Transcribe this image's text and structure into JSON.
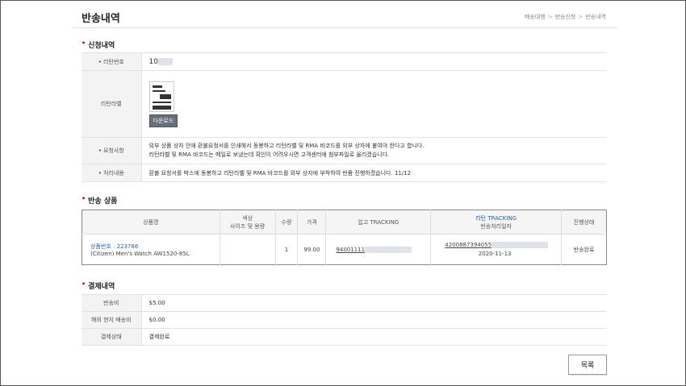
{
  "page": {
    "title": "반송내역",
    "breadcrumb": [
      "배송대행",
      "반송신청",
      "반송내역"
    ]
  },
  "application": {
    "section_title": "신청내역",
    "return_number": {
      "label": "리턴번호",
      "value": "10"
    },
    "return_label": {
      "label": "리턴라벨",
      "download_label": "다운로드"
    },
    "request": {
      "label": "요청사항",
      "line1": "외부 상품 상자 안에 환불요청서를 인쇄해서 동봉하고 리턴라벨 및 RMA 바코드를 외부 상자에 붙여야 한다고 합니다.",
      "line2": "리턴라벨 및 RMA 바코드는 메일로 보냈는데 확인이 어려우시면 고객센터에 첨부파일로 올리겠습니다."
    },
    "processing": {
      "label": "처리내용",
      "value": "환불 요청서를 박스에 동봉하고 리턴라벨 및 RMA 바코드를 외부 상자에 부착하여 반품 진행하겠습니다. 11/12"
    }
  },
  "products": {
    "section_title": "반송 상품",
    "headers": {
      "name": "상품명",
      "color": "색상",
      "size": "사이즈 및 용량",
      "qty": "수량",
      "price": "가격",
      "in_tracking": "입고 TRACKING",
      "return_tracking": "리턴 TRACKING",
      "return_date": "반송처리일자",
      "status": "진행상태"
    },
    "rows": [
      {
        "product_no": "상품번호 : 223786",
        "product_name": "(Citizen) Men's Watch AW1520-85L",
        "color_size": "",
        "qty": "1",
        "price": "99.00",
        "in_tracking": "94001111",
        "return_tracking": "4200887394055",
        "return_date": "2020-11-13",
        "status": "반송완료"
      }
    ]
  },
  "payment": {
    "section_title": "결제내역",
    "rows": [
      {
        "label": "반송비",
        "value": "$5.00"
      },
      {
        "label": "해외 현지 배송비",
        "value": "$0.00"
      },
      {
        "label": "결제상태",
        "value": "결제완료"
      }
    ]
  },
  "actions": {
    "list_button": "목록"
  },
  "colors": {
    "accent_blue": "#2a5db0",
    "required_red": "#cc0000",
    "button_gray": "#666f7a"
  }
}
